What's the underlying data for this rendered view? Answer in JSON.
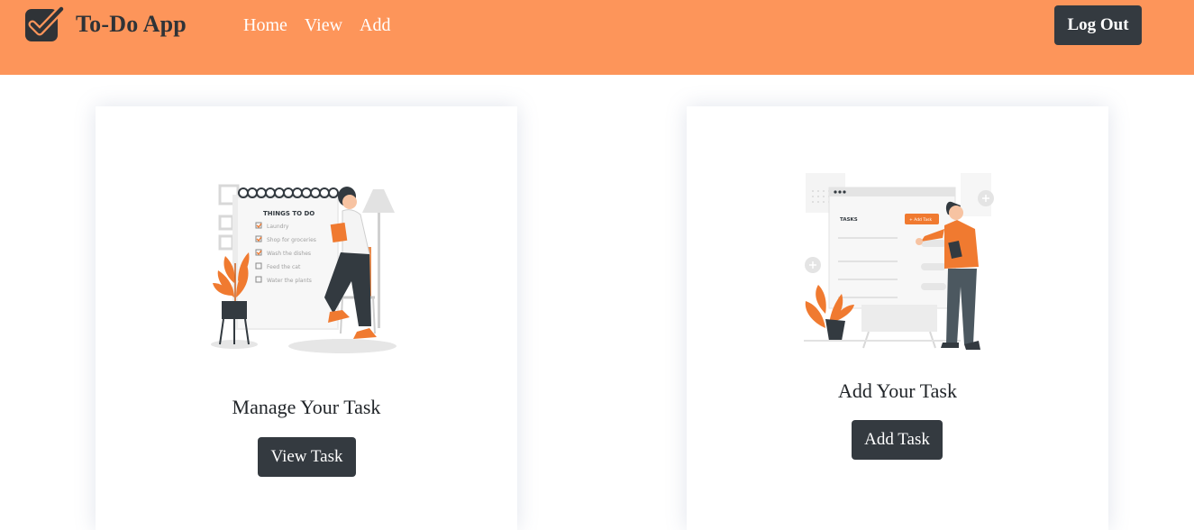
{
  "brand": {
    "title": "To-Do App"
  },
  "nav": {
    "links": [
      "Home",
      "View",
      "Add"
    ]
  },
  "header": {
    "logout_label": "Log Out"
  },
  "cards": [
    {
      "title": "Manage Your Task",
      "button_label": "View Task",
      "illustration": {
        "heading": "THINGS TO DO",
        "items": [
          "Laundry",
          "Shop for groceries",
          "Wash the dishes",
          "Feed the cat",
          "Water the plants"
        ]
      }
    },
    {
      "title": "Add Your Task",
      "button_label": "Add Task",
      "illustration": {
        "heading": "TASKS",
        "button": "+ Add Task"
      }
    }
  ],
  "colors": {
    "navbar": "#fd955a",
    "button": "#343a40",
    "accent": "#f07a30"
  }
}
